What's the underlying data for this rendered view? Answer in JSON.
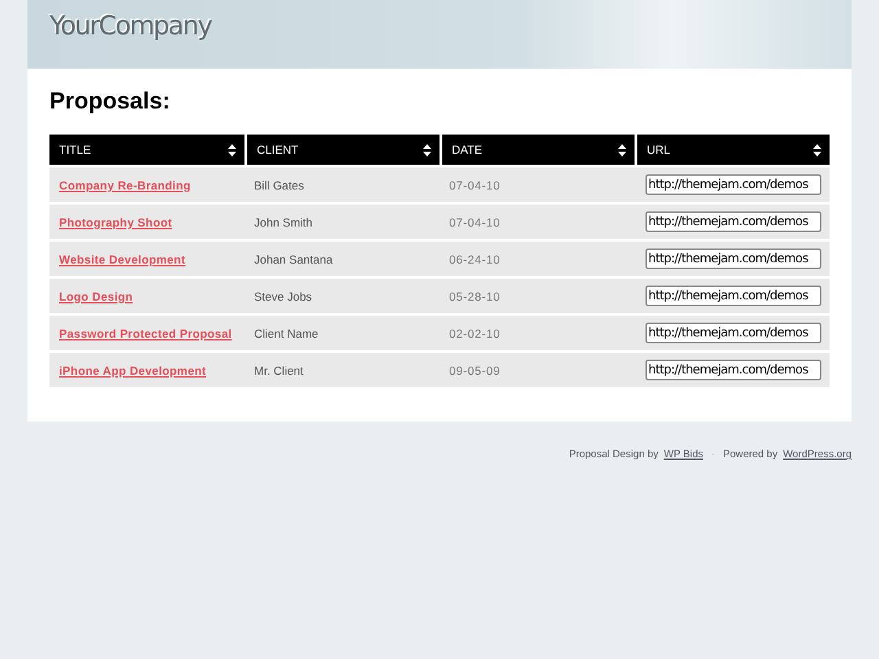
{
  "header": {
    "logo": "YourCompany"
  },
  "page_title": "Proposals:",
  "table": {
    "columns": [
      "TITLE",
      "CLIENT",
      "DATE",
      "URL"
    ],
    "rows": [
      {
        "title": "Company Re-Branding",
        "client": "Bill Gates",
        "date": "07-04-10",
        "url": "http://themejam.com/demos"
      },
      {
        "title": "Photography Shoot",
        "client": "John Smith",
        "date": "07-04-10",
        "url": "http://themejam.com/demos"
      },
      {
        "title": "Website Development",
        "client": "Johan Santana",
        "date": "06-24-10",
        "url": "http://themejam.com/demos"
      },
      {
        "title": "Logo Design",
        "client": "Steve Jobs",
        "date": "05-28-10",
        "url": "http://themejam.com/demos"
      },
      {
        "title": "Password Protected Proposal",
        "client": "Client Name",
        "date": "02-02-10",
        "url": "http://themejam.com/demos"
      },
      {
        "title": "iPhone App Development",
        "client": "Mr. Client",
        "date": "09-05-09",
        "url": "http://themejam.com/demos"
      }
    ]
  },
  "footer": {
    "credit_text": "Proposal Design by",
    "credit_link": "WP Bids",
    "separator": "·",
    "powered_text": "Powered by",
    "powered_link": "WordPress.org"
  }
}
